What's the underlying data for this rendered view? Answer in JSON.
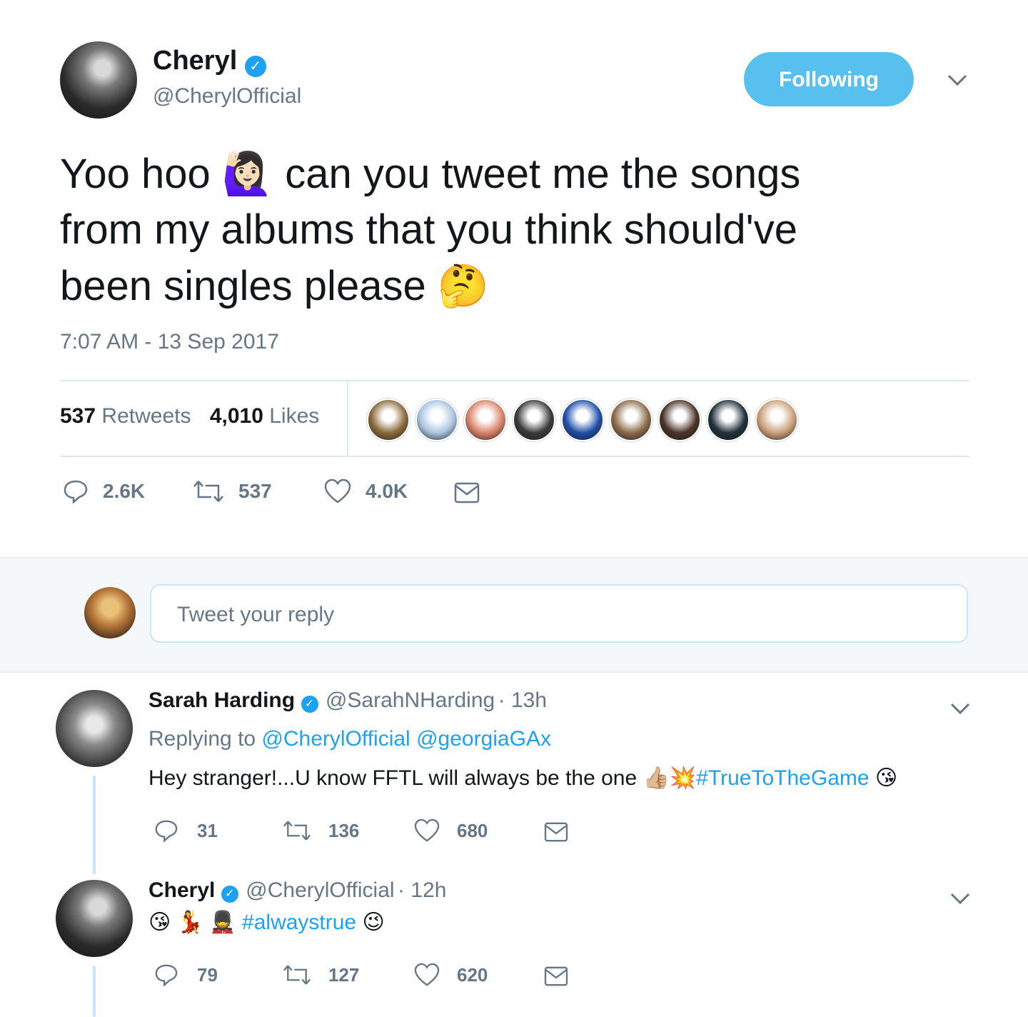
{
  "main_tweet": {
    "author_name": "Cheryl",
    "author_handle": "@CherylOfficial",
    "follow_label": "Following",
    "text_line1_a": "Yoo hoo",
    "emoji_1": "🙋🏻‍♀️",
    "text_line1_b": "can you tweet me the songs",
    "text_line2": "from my albums that you think should've",
    "text_line3": "been singles please",
    "emoji_2": "🤔",
    "timestamp": "7:07 AM - 13 Sep 2017",
    "retweets_count": "537",
    "retweets_label": "Retweets",
    "likes_count": "4,010",
    "likes_label": "Likes",
    "actions": {
      "reply_count": "2.6K",
      "retweet_count": "537",
      "like_count": "4.0K"
    }
  },
  "likers": [
    {
      "color": "#8a6a3c"
    },
    {
      "color": "#a9c4e0"
    },
    {
      "color": "#d8826a"
    },
    {
      "color": "#3a3a3a"
    },
    {
      "color": "#1f4fa8"
    },
    {
      "color": "#8b6b4a"
    },
    {
      "color": "#4a3428"
    },
    {
      "color": "#20303a"
    },
    {
      "color": "#c9a07a"
    }
  ],
  "reply_box": {
    "placeholder": "Tweet your reply"
  },
  "replies": [
    {
      "name": "Sarah Harding",
      "handle": "@SarahNHarding",
      "time": "· 13h",
      "replying_label": "Replying to",
      "replying_to_1": "@CherylOfficial",
      "replying_to_2": "@georgiaGAx",
      "text": "Hey stranger!...U know FFTL will always be the one",
      "emoji_a": "👍🏼",
      "emoji_b": "💥",
      "hashtag": "#TrueToTheGame",
      "emoji_c": "😘",
      "reply_count": "31",
      "retweet_count": "136",
      "like_count": "680"
    },
    {
      "name": "Cheryl",
      "handle": "@CherylOfficial",
      "time": "· 12h",
      "emoji_a": "😘",
      "emoji_b": "💃",
      "emoji_c": "💂",
      "hashtag": "#alwaystrue",
      "emoji_d": "😉",
      "reply_count": "79",
      "retweet_count": "127",
      "like_count": "620"
    }
  ],
  "colors": {
    "accent": "#1da1f2",
    "follow_button": "#58c0ee",
    "muted": "#657786"
  }
}
